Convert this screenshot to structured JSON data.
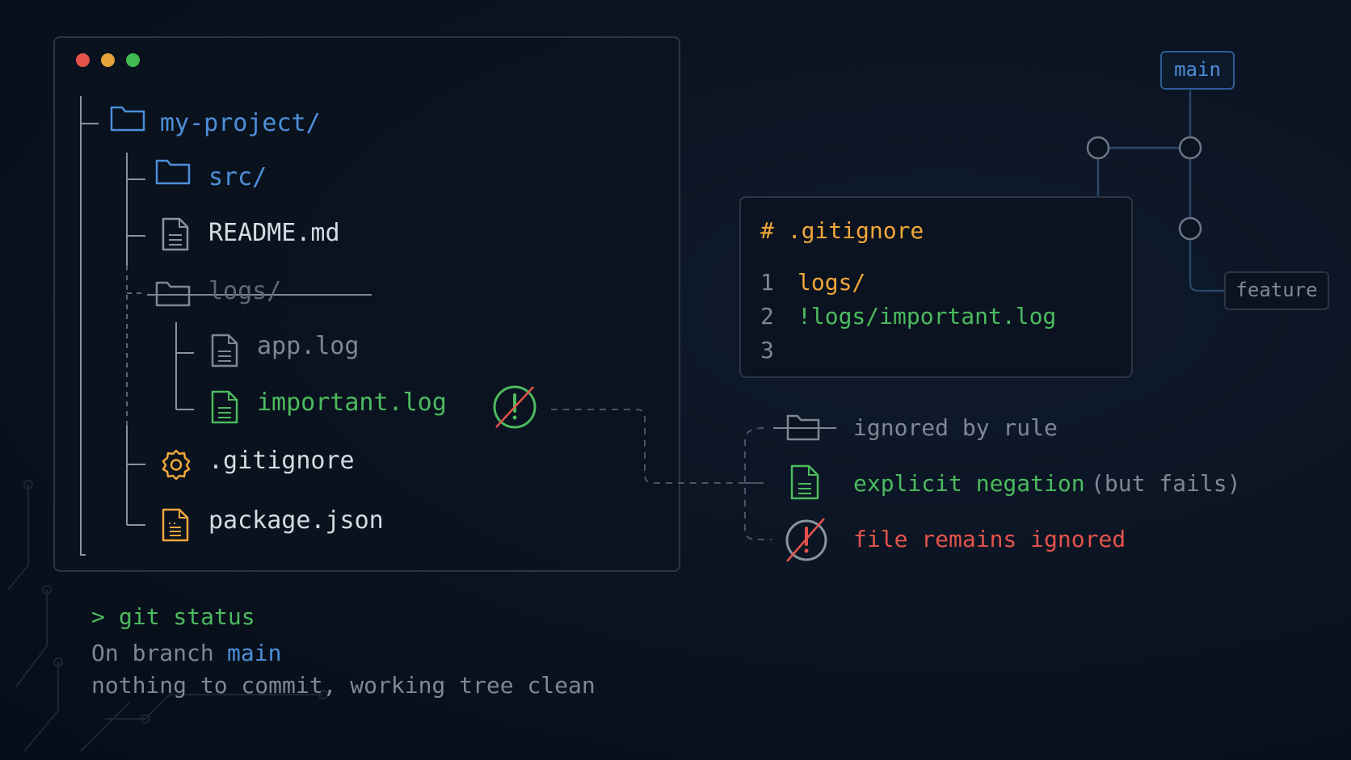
{
  "colors": {
    "background": "#0a1320",
    "folder": "#4c8fd9",
    "file": "#d5dbe3",
    "ignored": "#7e8794",
    "negation": "#4cbb5e",
    "config": "#f0a73a",
    "error": "#e5534b",
    "border": "#2a3546"
  },
  "window": {
    "controls": [
      "close",
      "minimize",
      "maximize"
    ],
    "tree": {
      "root": "my-project/",
      "items": [
        {
          "label": "src/",
          "type": "folder",
          "icon": "folder-icon"
        },
        {
          "label": "README.md",
          "type": "file",
          "icon": "file-icon"
        },
        {
          "label": "logs/",
          "type": "folder-ignored",
          "icon": "folder-icon"
        },
        {
          "label": "app.log",
          "type": "file-ignored",
          "icon": "file-icon"
        },
        {
          "label": "important.log",
          "type": "file-negated",
          "icon": "file-icon"
        },
        {
          "label": ".gitignore",
          "type": "config",
          "icon": "gear-icon"
        },
        {
          "label": "package.json",
          "type": "json",
          "icon": "json-file-icon"
        }
      ]
    }
  },
  "gitignore_panel": {
    "title": "# .gitignore",
    "lines": [
      {
        "num": "1",
        "text": "logs/"
      },
      {
        "num": "2",
        "text": "!logs/important.log"
      },
      {
        "num": "3",
        "text": ""
      }
    ]
  },
  "git_graph": {
    "branches": [
      "main",
      "feature"
    ]
  },
  "legend": [
    {
      "icon": "folder-icon",
      "text": "ignored by rule",
      "extra": ""
    },
    {
      "icon": "file-icon",
      "text": "explicit negation",
      "extra": "(but fails)"
    },
    {
      "icon": "blocked-icon",
      "text": "file remains ignored",
      "extra": ""
    }
  ],
  "terminal": {
    "prompt": ">",
    "command": "git status",
    "line1_prefix": "On branch",
    "line1_branch": "main",
    "line2": "nothing to commit, working tree clean"
  }
}
